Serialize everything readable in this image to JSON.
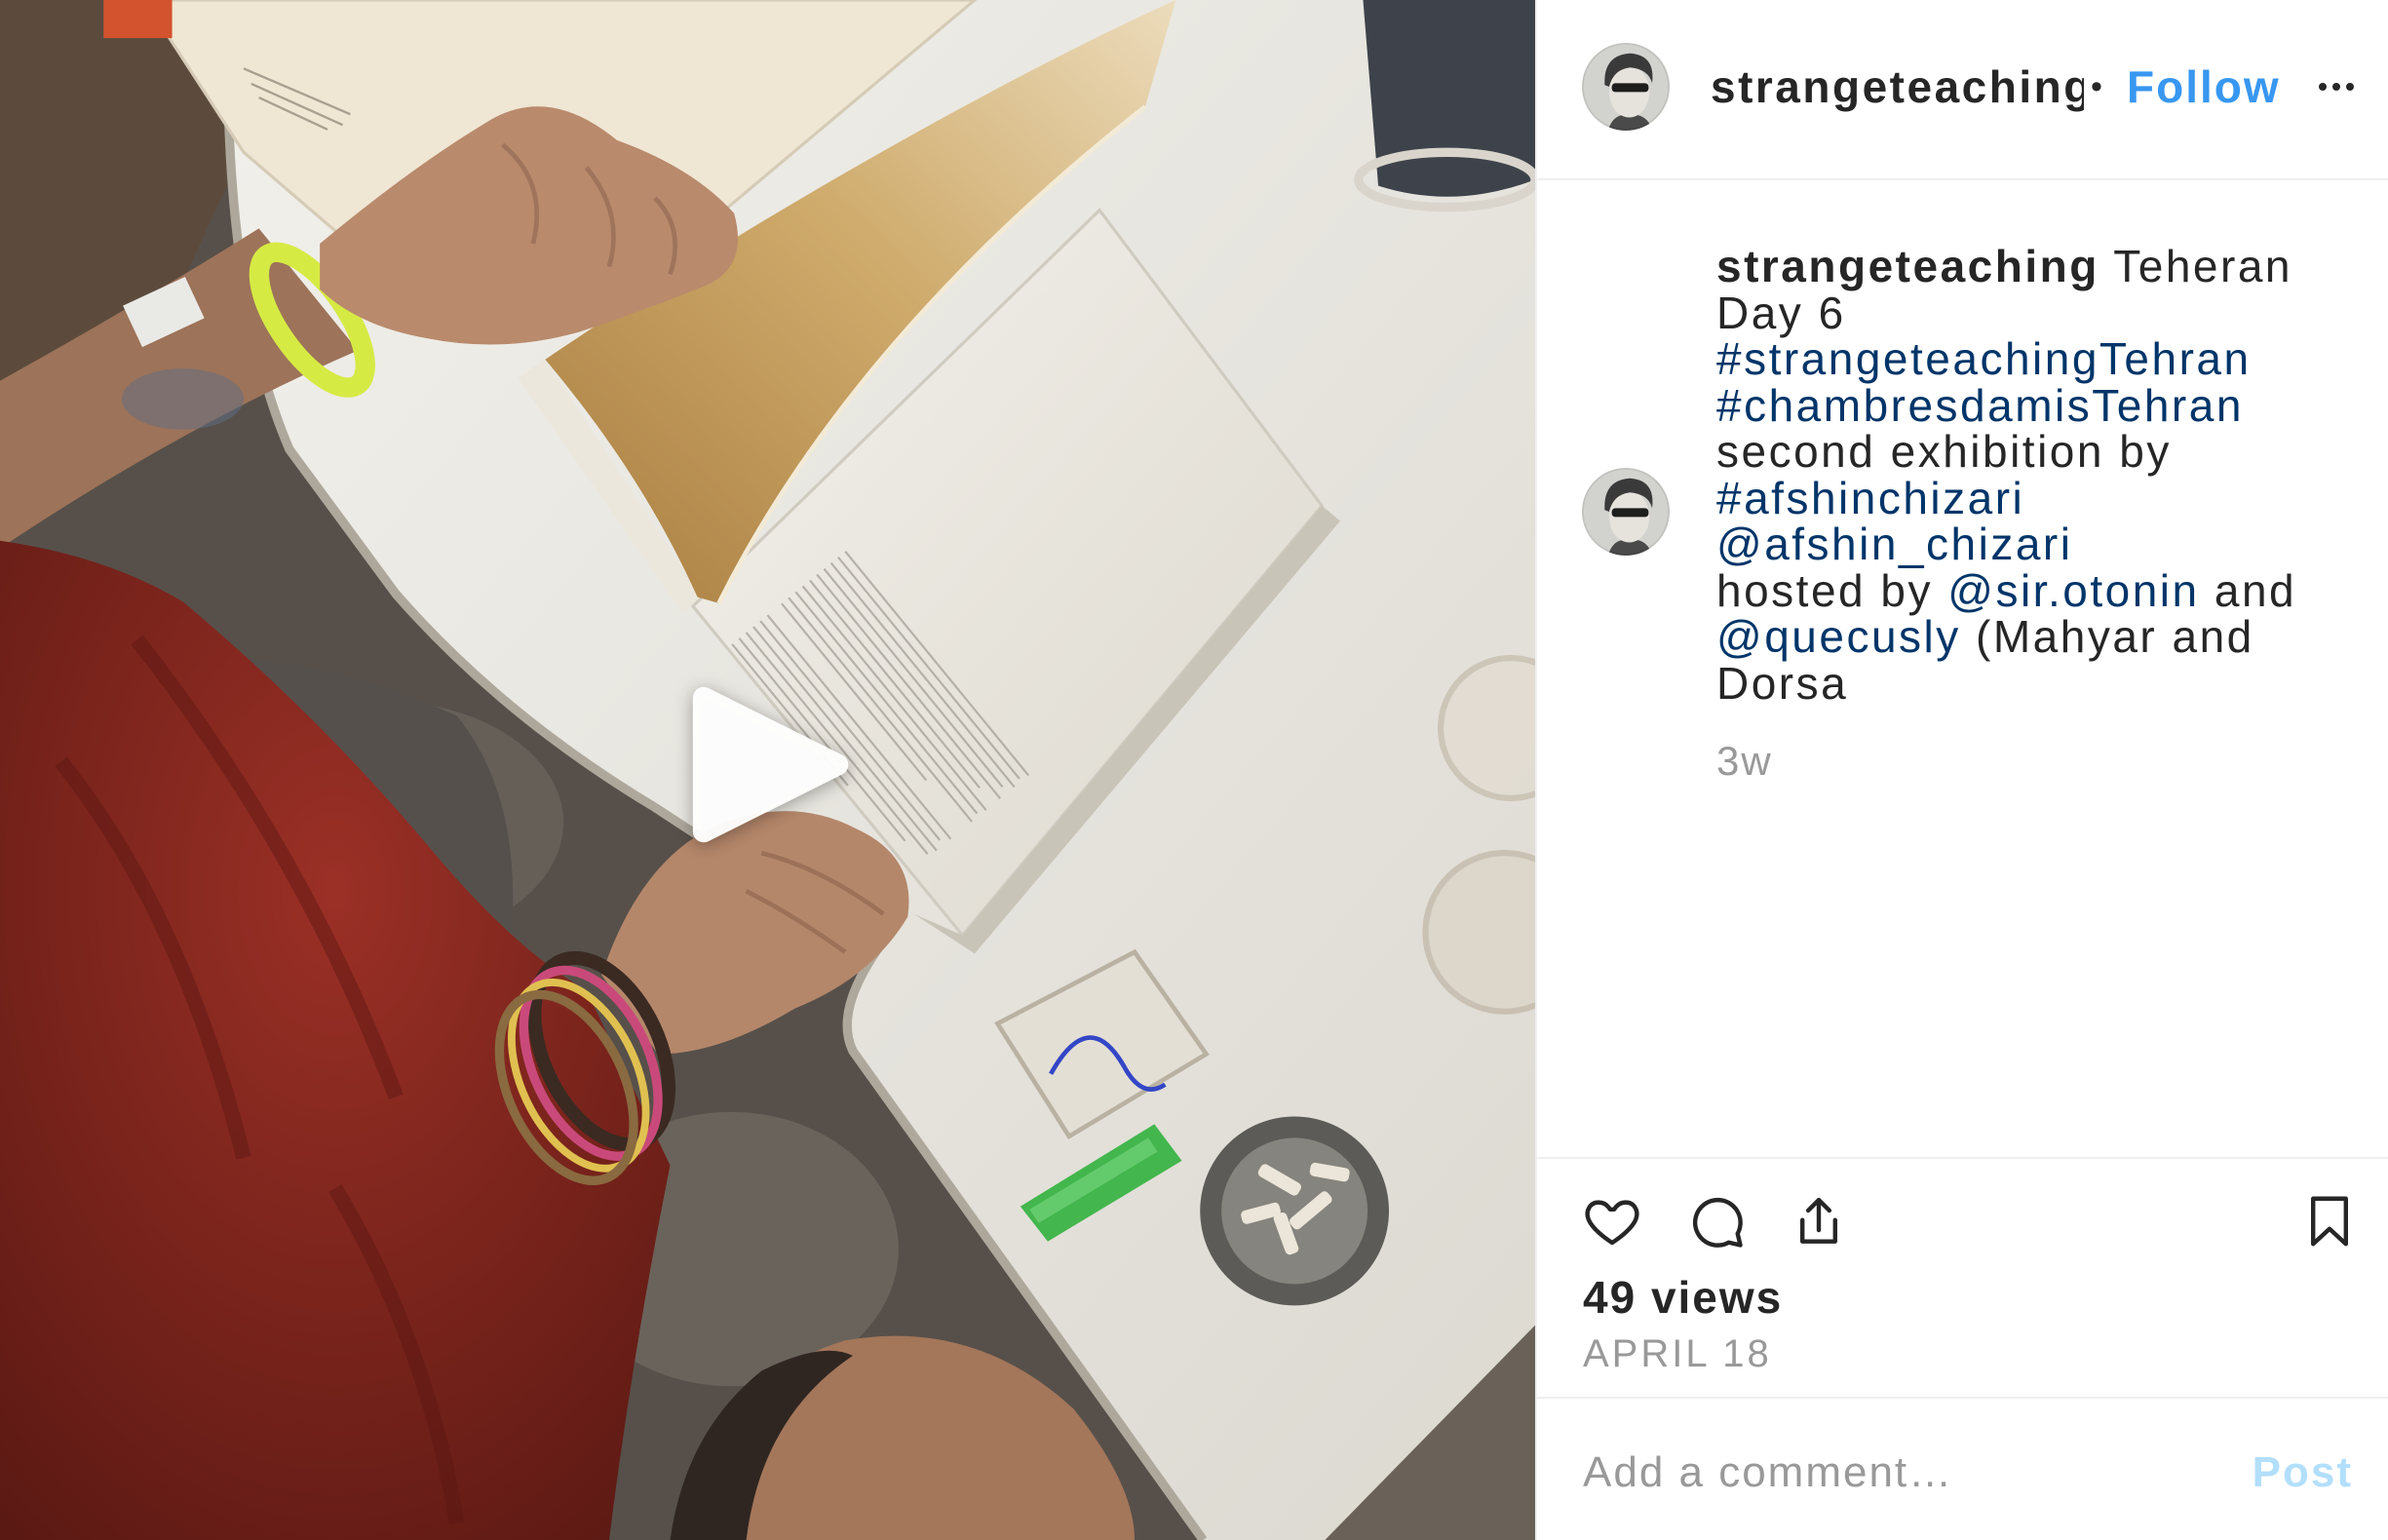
{
  "header": {
    "avatar_icon": "profile-avatar",
    "username": "strangeteaching",
    "separator": "•",
    "follow_label": "Follow",
    "more_icon": "more-options-icon"
  },
  "caption": {
    "avatar_icon": "profile-avatar",
    "lines": [
      [
        {
          "text": "strangeteaching",
          "link": false,
          "bold": true
        },
        {
          "text": " Teheran",
          "link": false
        }
      ],
      [
        {
          "text": "Day 6",
          "link": false
        }
      ],
      [
        {
          "text": "#strangeteachingTehran",
          "link": true
        }
      ],
      [
        {
          "text": "#chambresdamisTehran",
          "link": true
        }
      ],
      [
        {
          "text": "second exhibition by",
          "link": false
        }
      ],
      [
        {
          "text": "#afshinchizari",
          "link": true
        }
      ],
      [
        {
          "text": "@afshin_chizari",
          "link": true
        }
      ],
      [
        {
          "text": "hosted by ",
          "link": false
        },
        {
          "text": "@sir.otonin",
          "link": true
        },
        {
          "text": " and",
          "link": false
        }
      ],
      [
        {
          "text": "@quecusly",
          "link": true
        },
        {
          "text": " (Mahyar and",
          "link": false
        }
      ],
      [
        {
          "text": "Dorsa",
          "link": false
        }
      ]
    ],
    "timestamp": "3w"
  },
  "video": {
    "play_icon": "play-icon"
  },
  "actions": {
    "like_icon": "heart-icon",
    "comment_icon": "comment-icon",
    "share_icon": "share-icon",
    "save_icon": "bookmark-icon"
  },
  "stats": {
    "views": "49 views",
    "date": "APRIL 18"
  },
  "comment": {
    "placeholder": "Add a comment…",
    "post_label": "Post"
  },
  "colors": {
    "text": "#262626",
    "link": "#003569",
    "follow": "#3897f0",
    "muted": "#999999",
    "post_disabled": "#b2dffc",
    "divider": "#efefef"
  }
}
